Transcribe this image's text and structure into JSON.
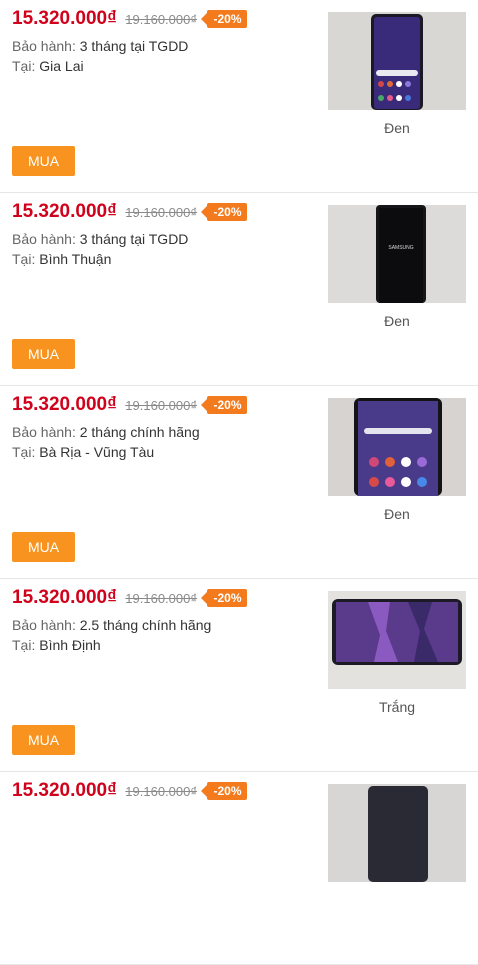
{
  "products": [
    {
      "price": "15.320.000₫",
      "old_price": "19.160.000₫",
      "discount": "-20%",
      "warranty_label": "Bảo hành:",
      "warranty": "3 tháng tại TGDD",
      "location_label": "Tại:",
      "location": "Gia Lai",
      "color": "Đen",
      "buy_label": "MUA",
      "image": "phone-home-screen"
    },
    {
      "price": "15.320.000₫",
      "old_price": "19.160.000₫",
      "discount": "-20%",
      "warranty_label": "Bảo hành:",
      "warranty": "3 tháng tại TGDD",
      "location_label": "Tại:",
      "location": "Bình Thuận",
      "color": "Đen",
      "buy_label": "MUA",
      "image": "phone-boot-screen",
      "brand_text": "SAMSUNG"
    },
    {
      "price": "15.320.000₫",
      "old_price": "19.160.000₫",
      "discount": "-20%",
      "warranty_label": "Bảo hành:",
      "warranty": "2 tháng chính hãng",
      "location_label": "Tại:",
      "location": "Bà Rịa - Vũng Tàu",
      "color": "Đen",
      "buy_label": "MUA",
      "image": "phone-home-screen"
    },
    {
      "price": "15.320.000₫",
      "old_price": "19.160.000₫",
      "discount": "-20%",
      "warranty_label": "Bảo hành:",
      "warranty": "2.5 tháng chính hãng",
      "location_label": "Tại:",
      "location": "Bình Định",
      "color": "Trắng",
      "buy_label": "MUA",
      "image": "phone-landscape-wallpaper"
    },
    {
      "price": "15.320.000₫",
      "old_price": "19.160.000₫",
      "discount": "-20%",
      "image": "phone-partial"
    }
  ],
  "colors": {
    "price": "#d0021b",
    "badge": "#f37b1d",
    "buy_button": "#f7931e"
  }
}
